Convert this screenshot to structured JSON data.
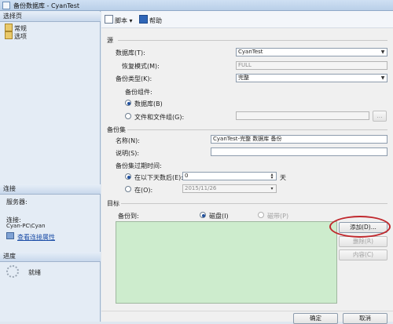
{
  "window": {
    "title": "备份数据库 - CyanTest"
  },
  "left": {
    "select_page_header": "选择页",
    "pages": [
      "常规",
      "选项"
    ],
    "connection_header": "连接",
    "server_label": "服务器:",
    "connection_label": "连接:",
    "connection_value": "Cyan-PC\\Cyan",
    "view_connection_props": "查看连接属性",
    "progress_header": "进度",
    "progress_status": "就绪"
  },
  "toolbar": {
    "script": "脚本",
    "help": "帮助"
  },
  "source": {
    "title": "源",
    "database_label": "数据库(T):",
    "database_value": "CyanTest",
    "recovery_label": "恢复模式(M):",
    "recovery_value": "FULL",
    "backup_type_label": "备份类型(K):",
    "backup_type_value": "完整",
    "component_label": "备份组件:",
    "radio_database": "数据库(B)",
    "radio_filegroup": "文件和文件组(G):",
    "filegroup_btn": "..."
  },
  "backup_set": {
    "title": "备份集",
    "name_label": "名称(N):",
    "name_value": "CyanTest-完整 数据库 备份",
    "desc_label": "说明(S):",
    "desc_value": "",
    "expire_label": "备份集过期时间:",
    "after_label": "在以下天数后(E):",
    "after_value": "0",
    "days_unit": "天",
    "on_label": "在(O):",
    "on_value": "2015/11/26"
  },
  "destination": {
    "title": "目标",
    "backup_to_label": "备份到:",
    "disk_label": "磁盘(I)",
    "tape_label": "磁带(P)",
    "add_btn": "添加(D)...",
    "remove_btn": "删除(R)",
    "contents_btn": "内容(C)"
  },
  "footer": {
    "ok_btn": "确定",
    "cancel_btn": "取消"
  },
  "colors": {
    "accent": "#1f4f9d",
    "highlight": "#c0282d",
    "list_bg": "#cdeccd"
  }
}
